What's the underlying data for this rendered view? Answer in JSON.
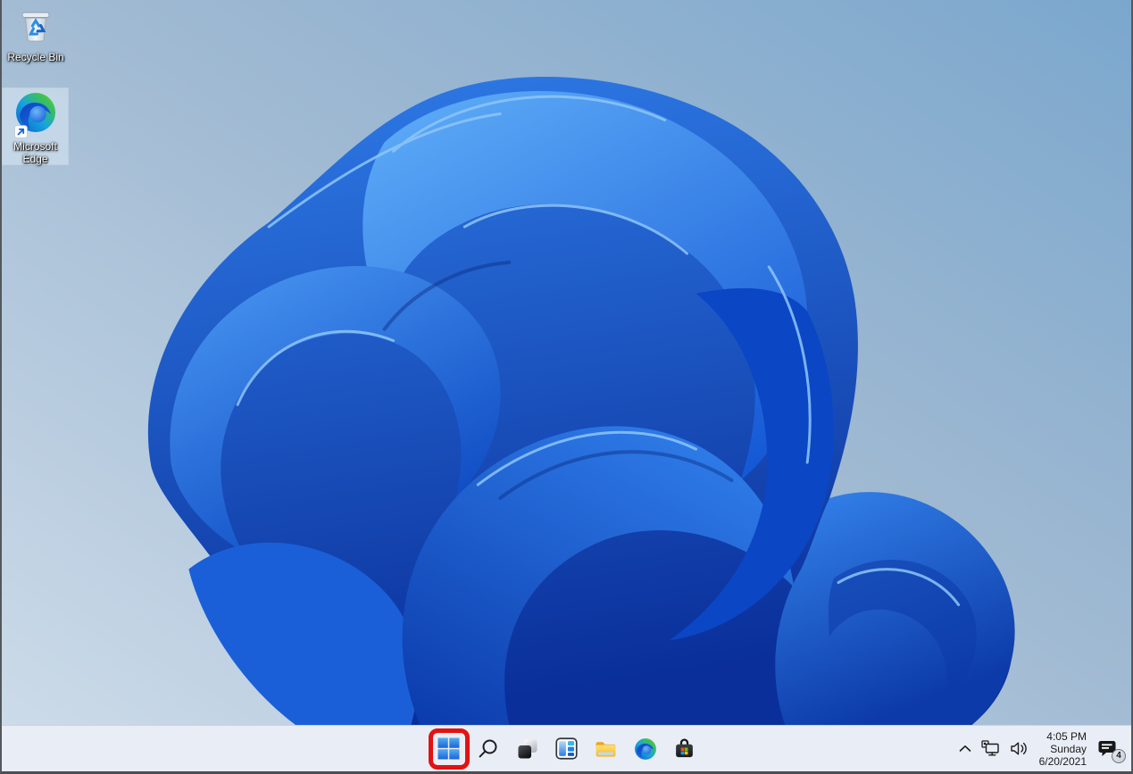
{
  "system": {
    "os_shell": "Windows 11 desktop"
  },
  "colors": {
    "annotation_red": "#e31212",
    "taskbar_bg": "#e9edf6",
    "start_logo_blue": "#2f86e0",
    "selection_highlight": "#d5e5f2",
    "wallpaper_base_blue": "#1659d6",
    "background_sky": "#7ba7cd"
  },
  "desktop": {
    "icons": [
      {
        "id": "recycle-bin",
        "label": "Recycle Bin",
        "selected": false
      },
      {
        "id": "microsoft-edge-shortcut",
        "label_line1": "Microsoft",
        "label_line2": "Edge",
        "selected": true
      }
    ]
  },
  "taskbar": {
    "buttons": [
      {
        "name": "Start",
        "icon": "windows-start-icon",
        "annotated": true
      },
      {
        "name": "Search",
        "icon": "search-icon"
      },
      {
        "name": "Task View",
        "icon": "task-view-icon"
      },
      {
        "name": "Widgets",
        "icon": "widgets-icon"
      },
      {
        "name": "File Explorer",
        "icon": "file-explorer-icon"
      },
      {
        "name": "Microsoft Edge",
        "icon": "edge-icon"
      },
      {
        "name": "Microsoft Store",
        "icon": "microsoft-store-icon"
      }
    ],
    "annotation": {
      "shape": "red-rounded-rectangle",
      "target": "Start"
    }
  },
  "tray": {
    "icons": [
      {
        "name": "Show hidden icons",
        "icon": "chevron-up-icon"
      },
      {
        "name": "Network",
        "icon": "network-ethernet-icon"
      },
      {
        "name": "Volume",
        "icon": "volume-icon"
      }
    ],
    "clock": {
      "time": "4:05 PM",
      "day": "Sunday",
      "date": "6/20/2021"
    },
    "notifications": {
      "icon": "notification-icon",
      "badge_count": "4"
    }
  }
}
